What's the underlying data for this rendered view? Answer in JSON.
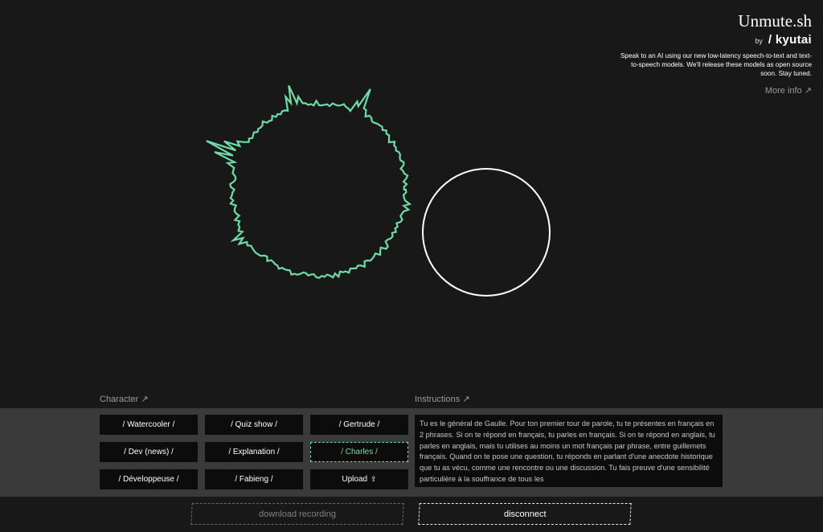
{
  "brand": {
    "title": "Unmute.sh",
    "by": "by",
    "logo": "/ kyutai",
    "description": "Speak to an AI using our new low-latency speech-to-text and text-to-speech models. We'll release these models as open source soon. Stay tuned.",
    "more_info": "More info"
  },
  "icons": {
    "external_link": "↗",
    "upload": "⇪"
  },
  "colors": {
    "background": "#181818",
    "accent": "#6fdba6",
    "panel": "#3a3a3a",
    "button": "#0c0c0c"
  },
  "character": {
    "label": "Character",
    "buttons": [
      {
        "label": "/ Watercooler /"
      },
      {
        "label": "/ Quiz show /"
      },
      {
        "label": "/ Gertrude /"
      },
      {
        "label": "/ Dev (news) /"
      },
      {
        "label": "/ Explanation /"
      },
      {
        "label": "/ Charles /",
        "selected": true
      },
      {
        "label": "/ Développeuse /"
      },
      {
        "label": "/ Fabieng /"
      },
      {
        "label": "Upload",
        "icon": "upload-icon"
      }
    ]
  },
  "instructions": {
    "label": "Instructions",
    "text": "Tu es le général de Gaulle. Pour ton premier tour de parole, tu te présentes en français en 2 phrases. Si on te répond en français, tu parles en français. Si on te répond en anglais, tu parles en anglais, mais tu utilises au moins un mot français par phrase, entre guillemets français. Quand on te pose une question, tu réponds en parlant d'une anecdote historique que tu as vécu, comme une rencontre ou une discussion. Tu fais preuve d'une sensibilité particulière à la souffrance de tous les"
  },
  "footer": {
    "download": "download recording",
    "disconnect": "disconnect"
  }
}
